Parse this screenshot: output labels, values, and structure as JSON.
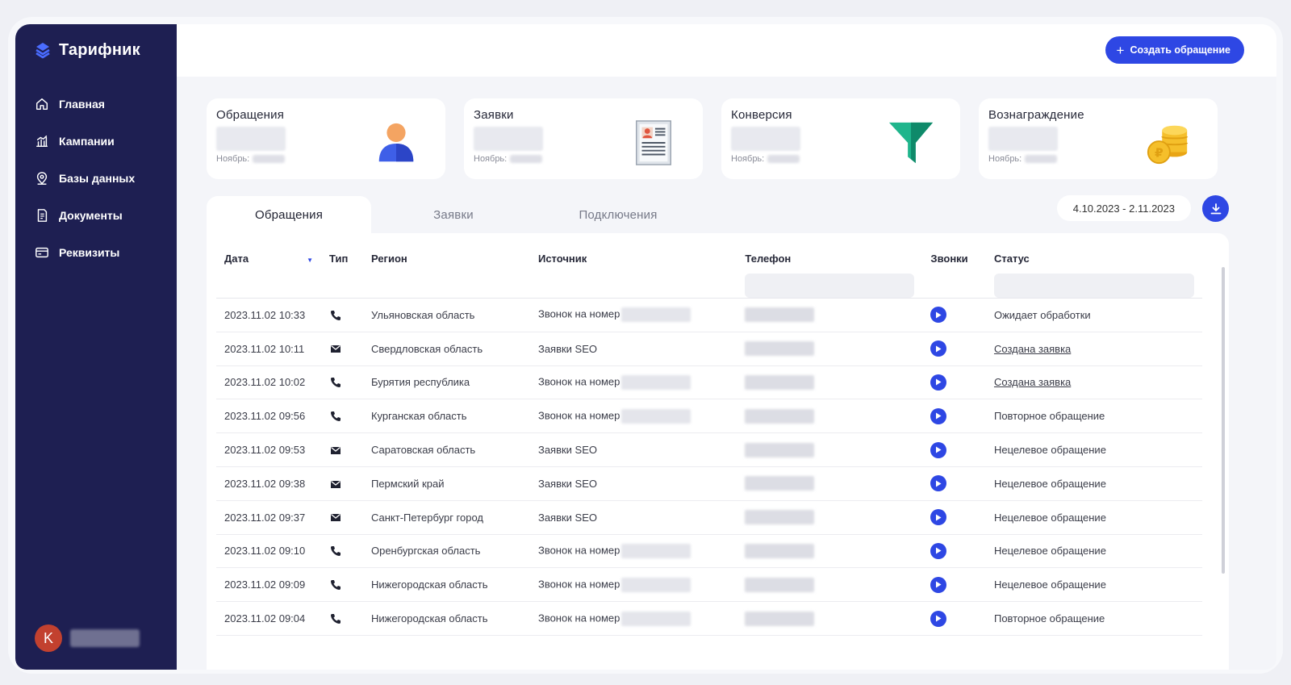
{
  "app": {
    "name": "Тарифник"
  },
  "sidebar": {
    "items": [
      {
        "label": "Главная",
        "icon": "home-icon"
      },
      {
        "label": "Кампании",
        "icon": "bar-chart-icon"
      },
      {
        "label": "Базы данных",
        "icon": "map-pin-icon"
      },
      {
        "label": "Документы",
        "icon": "document-icon"
      },
      {
        "label": "Реквизиты",
        "icon": "credit-card-icon"
      }
    ],
    "user": {
      "initial": "K"
    }
  },
  "header": {
    "create_button": "Создать обращение"
  },
  "cards": [
    {
      "title": "Обращения",
      "foot": "Ноябрь:",
      "icon": "user-icon"
    },
    {
      "title": "Заявки",
      "foot": "Ноябрь:",
      "icon": "form-icon"
    },
    {
      "title": "Конверсия",
      "foot": "Ноябрь:",
      "icon": "funnel-icon"
    },
    {
      "title": "Вознаграждение",
      "foot": "Ноябрь:",
      "icon": "coins-icon"
    }
  ],
  "tabs": [
    "Обращения",
    "Заявки",
    "Подключения"
  ],
  "date_range": "4.10.2023 - 2.11.2023",
  "table": {
    "columns": [
      "Дата",
      "Тип",
      "Регион",
      "Источник",
      "Телефон",
      "Звонки",
      "Статус"
    ],
    "rows": [
      {
        "date": "2023.11.02 10:33",
        "type": "phone",
        "region": "Ульяновская область",
        "source": "Звонок на номер",
        "status": "Ожидает обработки",
        "link": false
      },
      {
        "date": "2023.11.02 10:11",
        "type": "mail",
        "region": "Свердловская область",
        "source": "Заявки SEO",
        "status": "Создана заявка",
        "link": true
      },
      {
        "date": "2023.11.02 10:02",
        "type": "phone",
        "region": "Бурятия республика",
        "source": "Звонок на номер",
        "status": "Создана заявка",
        "link": true
      },
      {
        "date": "2023.11.02 09:56",
        "type": "phone",
        "region": "Курганская область",
        "source": "Звонок на номер",
        "status": "Повторное обращение",
        "link": false
      },
      {
        "date": "2023.11.02 09:53",
        "type": "mail",
        "region": "Саратовская область",
        "source": "Заявки SEO",
        "status": "Нецелевое обращение",
        "link": false
      },
      {
        "date": "2023.11.02 09:38",
        "type": "mail",
        "region": "Пермский край",
        "source": "Заявки SEO",
        "status": "Нецелевое обращение",
        "link": false
      },
      {
        "date": "2023.11.02 09:37",
        "type": "mail",
        "region": "Санкт-Петербург город",
        "source": "Заявки SEO",
        "status": "Нецелевое обращение",
        "link": false
      },
      {
        "date": "2023.11.02 09:10",
        "type": "phone",
        "region": "Оренбургская область",
        "source": "Звонок на номер",
        "status": "Нецелевое обращение",
        "link": false
      },
      {
        "date": "2023.11.02 09:09",
        "type": "phone",
        "region": "Нижегородская область",
        "source": "Звонок на номер",
        "status": "Нецелевое обращение",
        "link": false
      },
      {
        "date": "2023.11.02 09:04",
        "type": "phone",
        "region": "Нижегородская область",
        "source": "Звонок на номер",
        "status": "Повторное обращение",
        "link": false
      }
    ]
  },
  "colors": {
    "sidebar": "#1e1f52",
    "accent": "#2e47e4",
    "background": "#f4f5f9"
  }
}
